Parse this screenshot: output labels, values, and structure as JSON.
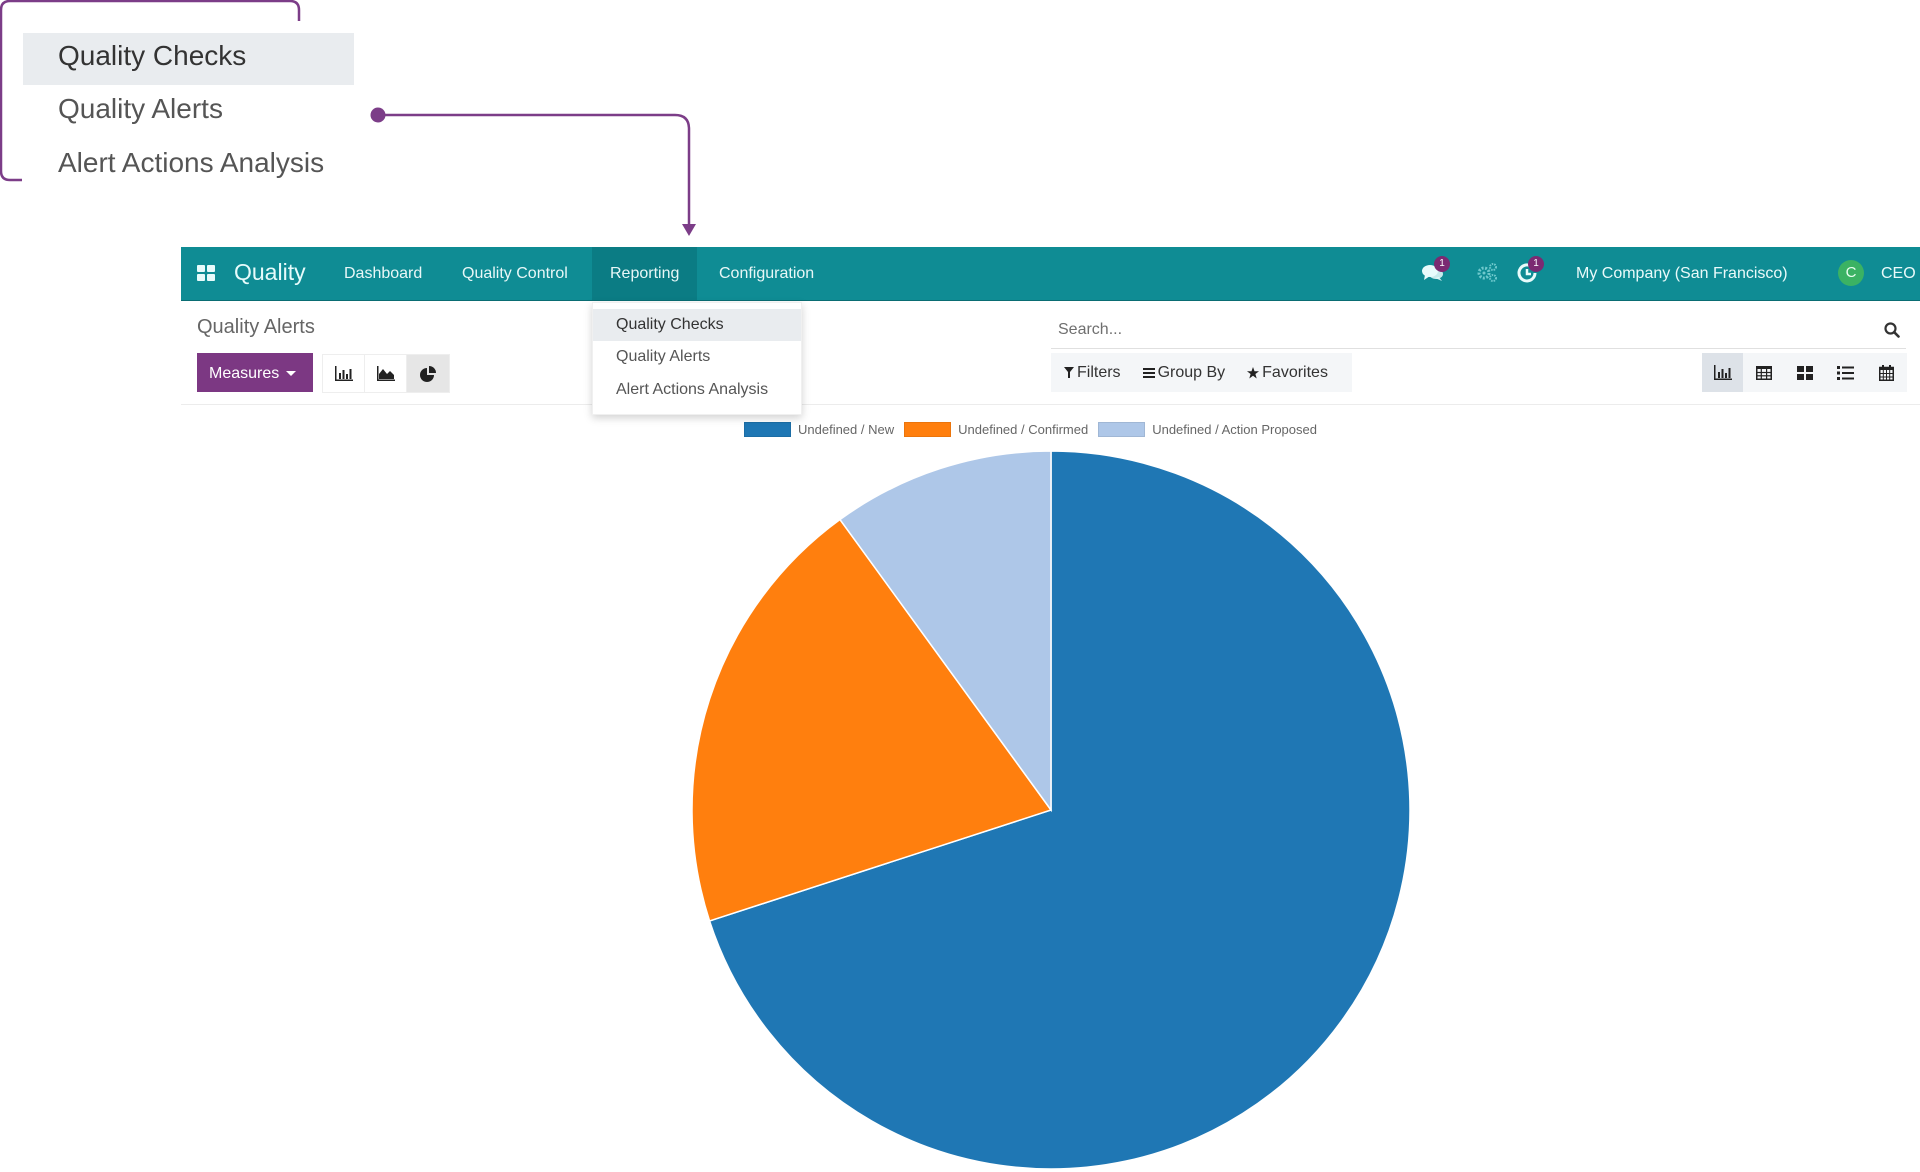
{
  "callout": {
    "items": [
      {
        "label": "Quality Checks",
        "active": true
      },
      {
        "label": "Quality Alerts",
        "active": false
      },
      {
        "label": "Alert Actions Analysis",
        "active": false
      }
    ],
    "accent_color": "#7c3d88"
  },
  "navbar": {
    "app_icon": "apps-grid-icon",
    "brand": "Quality",
    "menus": [
      "Dashboard",
      "Quality Control",
      "Reporting",
      "Configuration"
    ],
    "active_menu": "Reporting",
    "icons": [
      {
        "name": "discuss-icon",
        "badge": "1"
      },
      {
        "name": "gears-icon",
        "badge": null
      },
      {
        "name": "activity-icon",
        "badge": "1"
      }
    ],
    "company": "My Company (San Francisco)",
    "avatar_initial": "C",
    "user": "CEO",
    "bg_color": "#0f8c94"
  },
  "dropdown": {
    "items": [
      "Quality Checks",
      "Quality Alerts",
      "Alert Actions Analysis"
    ],
    "highlighted": "Quality Checks"
  },
  "control_panel": {
    "breadcrumb": "Quality Alerts",
    "measures_label": "Measures",
    "chart_types": [
      {
        "name": "bar-chart-icon",
        "active": false
      },
      {
        "name": "line-chart-icon",
        "active": false
      },
      {
        "name": "pie-chart-icon",
        "active": true
      }
    ],
    "search_placeholder": "Search...",
    "filters_label": "Filters",
    "group_by_label": "Group By",
    "favorites_label": "Favorites",
    "views": [
      {
        "name": "graph-view-icon",
        "active": true
      },
      {
        "name": "pivot-view-icon",
        "active": false
      },
      {
        "name": "kanban-view-icon",
        "active": false
      },
      {
        "name": "list-view-icon",
        "active": false
      },
      {
        "name": "calendar-view-icon",
        "active": false
      }
    ]
  },
  "chart_data": {
    "type": "pie",
    "title": "",
    "categories": [
      "Undefined / New",
      "Undefined / Confirmed",
      "Undefined / Action Proposed"
    ],
    "values": [
      70,
      20,
      10
    ],
    "unit": "percent (estimated)",
    "colors": [
      "#1f77b4",
      "#ff7f0e",
      "#aec7e8"
    ],
    "legend_position": "top",
    "start_angle": "12 o'clock",
    "direction": "clockwise"
  }
}
